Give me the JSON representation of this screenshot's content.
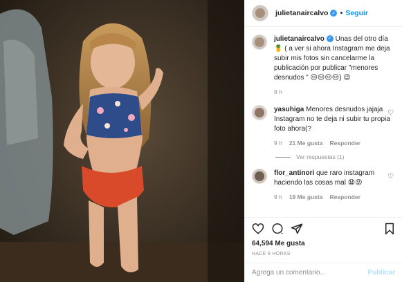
{
  "header": {
    "username": "julietanaircalvo",
    "verified_icon": "verified-badge-icon",
    "separator": "•",
    "follow_label": "Seguir"
  },
  "caption": {
    "username": "julietanaircalvo",
    "text": "Unas del otro día 🍍 ( a ver si ahora Instagram me deja subir mis fotos sin cancelarme la publicación por publicar \"menores desnudos \" 😑😑😑😑) 😉",
    "time": "9 h"
  },
  "comments": [
    {
      "username": "yasuhiga",
      "text": "Menores desnudos jajaja Instagram no te deja ni subir tu propia foto ahora(?",
      "time": "9 h",
      "likes": "21 Me gusta",
      "reply": "Responder",
      "replies_label": "Ver respuestas (1)"
    },
    {
      "username": "flor_antinori",
      "text": "que raro instagram haciendo las cosas mal 😧😡",
      "time": "9 h",
      "likes": "19 Me gusta",
      "reply": "Responder"
    }
  ],
  "actions": {
    "like_icon": "heart-icon",
    "comment_icon": "comment-icon",
    "share_icon": "share-icon",
    "save_icon": "bookmark-icon",
    "likes_count": "64,594 Me gusta",
    "posted": "HACE 9 HORAS"
  },
  "composer": {
    "placeholder": "Agrega un comentario...",
    "post_label": "Publicar"
  },
  "colors": {
    "link_blue": "#0095f6",
    "verified_blue": "#3897f0",
    "disabled_blue": "#b2dffc",
    "muted": "#8e8e8e"
  }
}
